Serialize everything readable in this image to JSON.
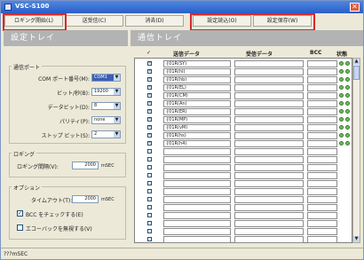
{
  "window": {
    "title": "VSC-S100",
    "close": "✕"
  },
  "toolbar": {
    "buttons": [
      "ロギング開始(L)",
      "送受信(C)",
      "消去(D)",
      "設定読込(O)",
      "設定保存(W)"
    ]
  },
  "markers": [
    "1",
    "2"
  ],
  "left_panel": {
    "header": "設定トレイ",
    "comm_port": {
      "title": "通信ポート",
      "fields": [
        {
          "label": "COM ポート番号(M):",
          "value": "COM1"
        },
        {
          "label": "ビット/秒(B):",
          "value": "19200"
        },
        {
          "label": "データビット(D):",
          "value": "8"
        },
        {
          "label": "パリティ(P):",
          "value": "none"
        },
        {
          "label": "ストップ ビット(S):",
          "value": "2"
        }
      ]
    },
    "logging": {
      "title": "ロギング",
      "interval_label": "ロギング間隔(V):",
      "interval_value": "2000",
      "unit": "mSEC"
    },
    "options": {
      "title": "オプション",
      "timeout_label": "タイムアウト(T):",
      "timeout_value": "2000",
      "unit": "mSEC",
      "bcc_label": "BCC をチェックする(E)",
      "echo_label": "エコーバックを無視する(V)"
    }
  },
  "right_panel": {
    "header": "通信トレイ",
    "columns": {
      "check": "✓",
      "send": "送信データ",
      "recv": "受信データ",
      "bcc": "BCC",
      "status": "状態"
    },
    "rows": [
      "{01R(SY)",
      "{01R(hl)",
      "{01R(hb)",
      "{01R(EL)",
      "{01R(CM)",
      "{01R(An)",
      "{01R(ER)",
      "{01R(MP)",
      "{01R(vM)",
      "{01R(hs)",
      "{01R(h4)",
      "",
      "",
      "",
      "",
      "",
      "",
      "",
      "",
      "",
      "",
      "",
      ""
    ],
    "checked_rows": 11,
    "rows_with_status": 11
  },
  "statusbar": {
    "text": "???mSEC"
  }
}
